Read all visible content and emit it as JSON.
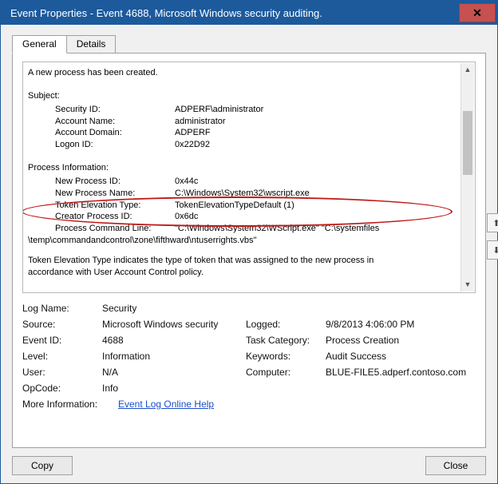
{
  "window": {
    "title": "Event Properties - Event 4688, Microsoft Windows security auditing.",
    "close_glyph": "✕"
  },
  "tabs": {
    "general": "General",
    "details": "Details"
  },
  "desc": {
    "created": "A new process has been created.",
    "subject_h": "Subject:",
    "sid_k": "Security ID:",
    "sid_v": "ADPERF\\administrator",
    "acct_k": "Account Name:",
    "acct_v": "administrator",
    "dom_k": "Account Domain:",
    "dom_v": "ADPERF",
    "logon_k": "Logon ID:",
    "logon_v": "0x22D92",
    "pi_h": "Process Information:",
    "npid_k": "New Process ID:",
    "npid_v": "0x44c",
    "npn_k": "New Process Name:",
    "npn_v": "C:\\Windows\\System32\\wscript.exe",
    "tet_k": "Token Elevation Type:",
    "tet_v": "TokenElevationTypeDefault (1)",
    "cpid_k": "Creator Process ID:",
    "cpid_v": "0x6dc",
    "pcl_k": "Process Command Line:",
    "pcl_v": "\"C:\\Windows\\System32\\WScript.exe\" \"C:\\systemfiles",
    "pcl_wrap": "\\temp\\commandandcontrol\\zone\\fifthward\\ntuserrights.vbs\"",
    "tet_note1": "Token Elevation Type indicates the type of token that was assigned to the new process in",
    "tet_note2": "accordance with User Account Control policy."
  },
  "meta": {
    "logname_k": "Log Name:",
    "logname_v": "Security",
    "source_k": "Source:",
    "source_v": "Microsoft Windows security",
    "logged_k": "Logged:",
    "logged_v": "9/8/2013 4:06:00 PM",
    "eventid_k": "Event ID:",
    "eventid_v": "4688",
    "taskcat_k": "Task Category:",
    "taskcat_v": "Process Creation",
    "level_k": "Level:",
    "level_v": "Information",
    "keywords_k": "Keywords:",
    "keywords_v": "Audit Success",
    "user_k": "User:",
    "user_v": "N/A",
    "computer_k": "Computer:",
    "computer_v": "BLUE-FILE5.adperf.contoso.com",
    "opcode_k": "OpCode:",
    "opcode_v": "Info",
    "moreinfo_k": "More Information:",
    "moreinfo_link": "Event Log Online Help"
  },
  "buttons": {
    "copy": "Copy",
    "close": "Close"
  },
  "glyphs": {
    "up": "▲",
    "down": "▼",
    "arrow_up": "⬆",
    "arrow_down": "⬇"
  }
}
